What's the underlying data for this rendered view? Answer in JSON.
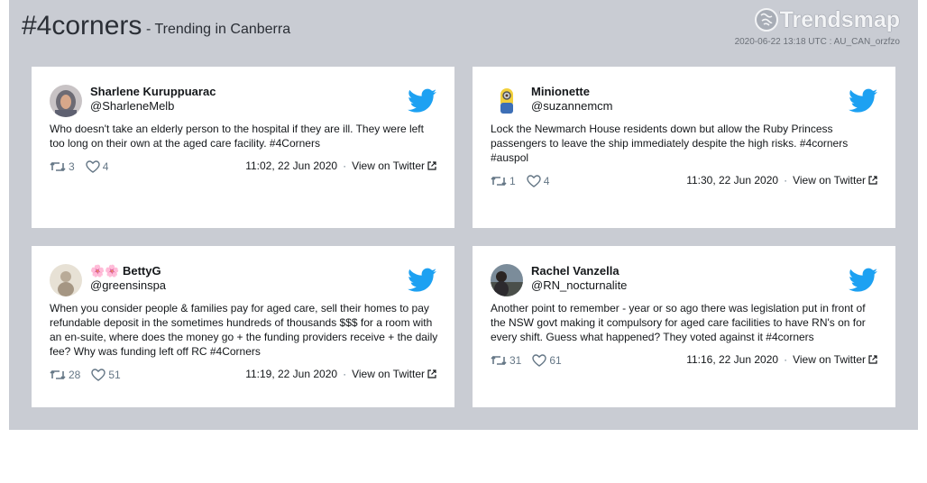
{
  "header": {
    "hashtag": "#4corners",
    "subtitle": "- Trending in Canberra",
    "logo_text": "Trendsmap",
    "meta": "2020-06-22 13:18 UTC : AU_CAN_orzfzo"
  },
  "colors": {
    "panel": "#c9ccd3",
    "twitter_blue": "#1da1f2"
  },
  "tweets": [
    {
      "name": "Sharlene Kuruppuarac",
      "handle": "@SharleneMelb",
      "text": "Who doesn't take an elderly person to the hospital if they are ill. They were left too long on their own at the aged care facility. #4Corners",
      "retweets": "3",
      "likes": "4",
      "time": "11:02, 22 Jun 2020",
      "view": "View on Twitter"
    },
    {
      "name": "Minionette",
      "handle": "@suzannemcm",
      "text": "Lock the Newmarch House residents down but allow the Ruby Princess passengers to leave the ship immediately despite the high risks. #4corners #auspol",
      "retweets": "1",
      "likes": "4",
      "time": "11:30, 22 Jun 2020",
      "view": "View on Twitter"
    },
    {
      "name": "🌸🌸 BettyG",
      "handle": "@greensinspa",
      "text": "When you consider people & families pay for aged care, sell their homes to pay refundable deposit in the sometimes hundreds of thousands $$$ for a room with an en-suite, where does the money go + the funding providers receive + the daily fee? Why was funding left off RC #4Corners",
      "retweets": "28",
      "likes": "51",
      "time": "11:19, 22 Jun 2020",
      "view": "View on Twitter"
    },
    {
      "name": "Rachel Vanzella",
      "handle": "@RN_nocturnalite",
      "text": "Another point to remember - year or so ago there was legislation put in front of the NSW govt making it compulsory for aged care facilities to have RN's on for every shift. Guess what happened? They voted against it #4corners",
      "retweets": "31",
      "likes": "61",
      "time": "11:16, 22 Jun 2020",
      "view": "View on Twitter"
    }
  ]
}
